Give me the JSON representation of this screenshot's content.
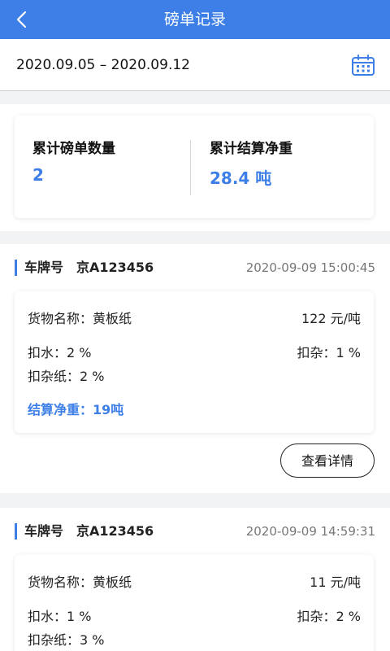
{
  "header": {
    "title": "磅单记录",
    "back_icon": "chevron-left-icon"
  },
  "date_bar": {
    "range": "2020.09.05 – 2020.09.12",
    "calendar_icon": "calendar-icon"
  },
  "summary": {
    "count_label": "累计磅单数量",
    "count_value": "2",
    "weight_label": "累计结算净重",
    "weight_value": "28.4 吨"
  },
  "records": [
    {
      "plate_label": "车牌号",
      "plate": "京A123456",
      "time": "2020-09-09 15:00:45",
      "goods": "货物名称：黄板纸",
      "price": "122 元/吨",
      "water": "扣水：2 %",
      "impurity": "扣杂：1 %",
      "paper": "扣杂纸：2 %",
      "net": "结算净重：19吨",
      "detail_button": "查看详情"
    },
    {
      "plate_label": "车牌号",
      "plate": "京A123456",
      "time": "2020-09-09 14:59:31",
      "goods": "货物名称：黄板纸",
      "price": "11 元/吨",
      "water": "扣水：1 %",
      "impurity": "扣杂：2 %",
      "paper": "扣杂纸：3 %"
    }
  ],
  "colors": {
    "accent": "#3d7fe6",
    "background": "#f2f3f5"
  }
}
